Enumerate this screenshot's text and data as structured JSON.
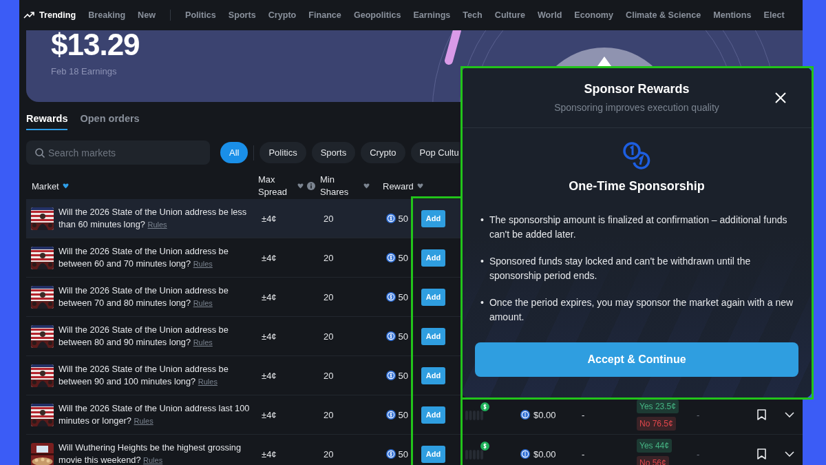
{
  "nav": {
    "primary": [
      {
        "label": "Trending",
        "selected": true
      },
      {
        "label": "Breaking",
        "selected": false
      },
      {
        "label": "New",
        "selected": false
      }
    ],
    "topics": [
      "Politics",
      "Sports",
      "Crypto",
      "Finance",
      "Geopolitics",
      "Earnings",
      "Tech",
      "Culture",
      "World",
      "Economy",
      "Climate & Science",
      "Mentions",
      "Elect"
    ]
  },
  "hero": {
    "amount": "$13.29",
    "caption": "Feb 18 Earnings"
  },
  "tabs": [
    {
      "label": "Rewards",
      "selected": true
    },
    {
      "label": "Open orders",
      "selected": false
    }
  ],
  "search": {
    "placeholder": "Search markets"
  },
  "filters": [
    {
      "label": "All",
      "selected": true
    },
    {
      "label": "Politics",
      "selected": false
    },
    {
      "label": "Sports",
      "selected": false
    },
    {
      "label": "Crypto",
      "selected": false
    },
    {
      "label": "Pop Cultu",
      "selected": false
    }
  ],
  "table": {
    "columns": [
      {
        "label": "Market",
        "sort_active": true,
        "info": false
      },
      {
        "label": "Max Spread",
        "sort_active": false,
        "info": true
      },
      {
        "label": "Min Shares",
        "sort_active": false,
        "info": false
      },
      {
        "label": "Reward",
        "sort_active": false,
        "info": false
      }
    ],
    "rows": [
      {
        "question": "Will the 2026 State of the Union address be less than 60 minutes long?",
        "rules": "Rules",
        "max_spread": "±4¢",
        "min_shares": "20",
        "reward": "50",
        "action": "Add",
        "hovered": true
      },
      {
        "question": "Will the 2026 State of the Union address be between 60 and 70 minutes long?",
        "rules": "Rules",
        "max_spread": "±4¢",
        "min_shares": "20",
        "reward": "50",
        "action": "Add",
        "hovered": false
      },
      {
        "question": "Will the 2026 State of the Union address be between 70 and 80 minutes long?",
        "rules": "Rules",
        "max_spread": "±4¢",
        "min_shares": "20",
        "reward": "50",
        "action": "Add",
        "hovered": false
      },
      {
        "question": "Will the 2026 State of the Union address be between 80 and 90 minutes long?",
        "rules": "Rules",
        "max_spread": "±4¢",
        "min_shares": "20",
        "reward": "50",
        "action": "Add",
        "hovered": false
      },
      {
        "question": "Will the 2026 State of the Union address be between 90 and 100 minutes long?",
        "rules": "Rules",
        "max_spread": "±4¢",
        "min_shares": "20",
        "reward": "50",
        "action": "Add",
        "hovered": false
      },
      {
        "question": "Will the 2026 State of the Union address last 100 minutes or longer?",
        "rules": "Rules",
        "max_spread": "±4¢",
        "min_shares": "20",
        "reward": "50",
        "action": "Add",
        "hovered": false,
        "details": {
          "amount": "$0.00",
          "column_7": "-",
          "yes": "Yes 23.5¢",
          "no": "No 76.5¢",
          "column_9": "-"
        }
      },
      {
        "question": "Will Wuthering Heights be the highest grossing movie this weekend?",
        "rules": "Rules",
        "max_spread": "±4¢",
        "min_shares": "20",
        "reward": "50",
        "action": "Add",
        "hovered": false,
        "details": {
          "amount": "$0.00",
          "column_7": "-",
          "yes": "Yes 44¢",
          "no": "No 56¢",
          "column_9": "-"
        }
      }
    ]
  },
  "modal": {
    "title": "Sponsor Rewards",
    "subtitle": "Sponsoring improves execution quality",
    "heading": "One-Time Sponsorship",
    "bullets": [
      {
        "marker": "•",
        "text": "The sponsorship amount is finalized at confirmation – additional funds can't be added later."
      },
      {
        "marker": "•",
        "text": "Sponsored funds stay locked and can't be withdrawn until the sponsorship period ends."
      },
      {
        "marker": "•",
        "text": "Once the period expires, you may sponsor the market again with a new amount."
      }
    ],
    "button": "Accept & Continue"
  }
}
